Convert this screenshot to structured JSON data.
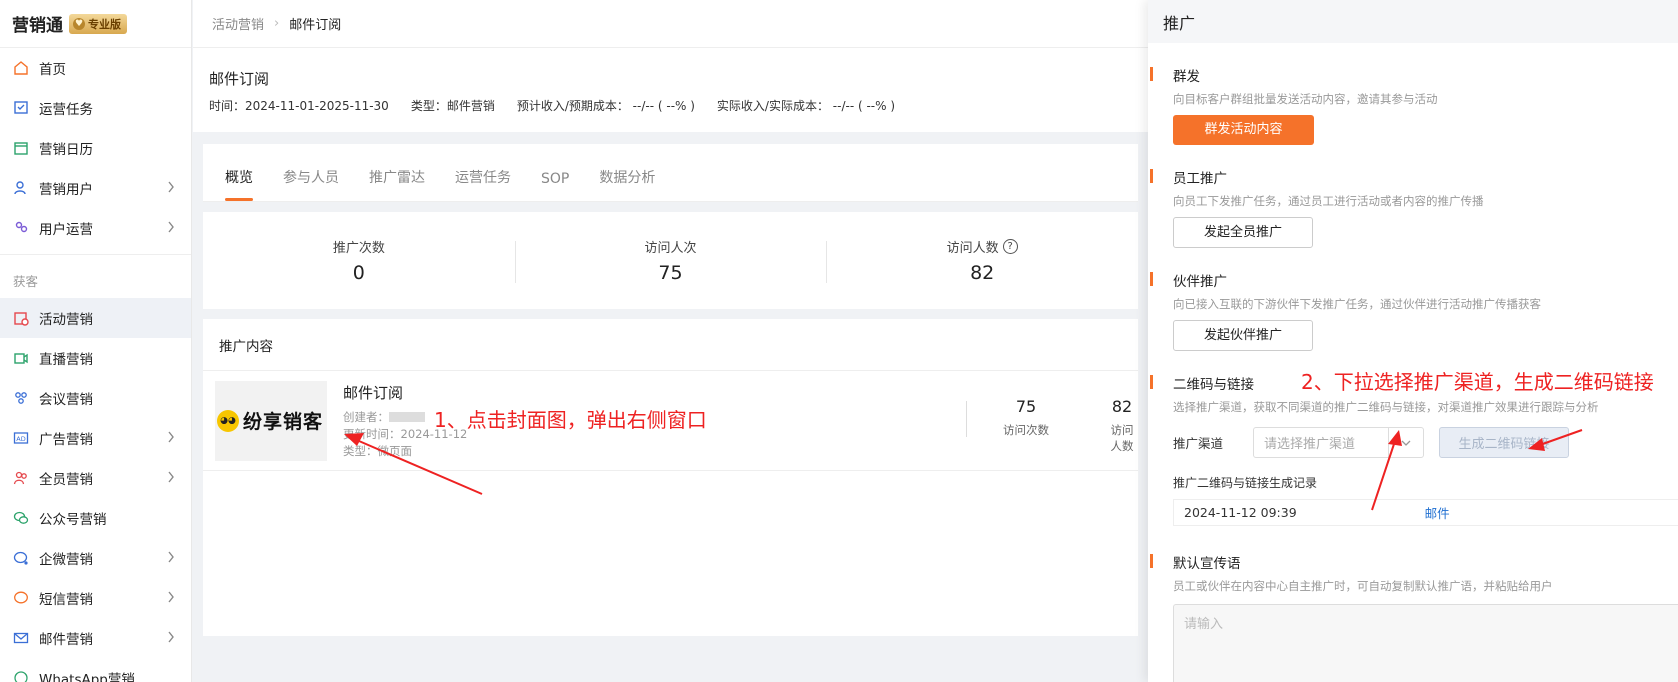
{
  "brand": {
    "name": "营销通",
    "badge": "专业版"
  },
  "sidebar": {
    "items": [
      {
        "label": "首页",
        "icon": "home-icon"
      },
      {
        "label": "运营任务",
        "icon": "task-icon"
      },
      {
        "label": "营销日历",
        "icon": "calendar-icon"
      },
      {
        "label": "营销用户",
        "icon": "user-icon"
      },
      {
        "label": "用户运营",
        "icon": "users-icon"
      }
    ],
    "group_label": "获客",
    "group_items": [
      {
        "label": "活动营销",
        "icon": "activity-icon"
      },
      {
        "label": "直播营销",
        "icon": "video-icon"
      },
      {
        "label": "会议营销",
        "icon": "meeting-icon"
      },
      {
        "label": "广告营销",
        "icon": "ad-icon"
      },
      {
        "label": "全员营销",
        "icon": "people-icon"
      },
      {
        "label": "公众号营销",
        "icon": "wechat-icon"
      },
      {
        "label": "企微营销",
        "icon": "wecom-icon"
      },
      {
        "label": "短信营销",
        "icon": "sms-icon"
      },
      {
        "label": "邮件营销",
        "icon": "mail-icon"
      },
      {
        "label": "WhatsApp营销",
        "icon": "whatsapp-icon"
      }
    ]
  },
  "breadcrumb": {
    "parent": "活动营销",
    "current": "邮件订阅"
  },
  "header": {
    "title": "邮件订阅",
    "time": "时间：2024-11-01-2025-11-30",
    "type": "类型：邮件营销",
    "expected": "预计收入/预期成本： --/-- ( --% )",
    "actual": "实际收入/实际成本： --/-- ( --% )"
  },
  "tabs": [
    "概览",
    "参与人员",
    "推广雷达",
    "运营任务",
    "SOP",
    "数据分析"
  ],
  "stats": [
    {
      "label": "推广次数",
      "value": "0"
    },
    {
      "label": "访问人次",
      "value": "75"
    },
    {
      "label": "访问人数",
      "value": "82"
    }
  ],
  "content": {
    "section_title": "推广内容",
    "item": {
      "cover_text": "纷享销客",
      "title": "邮件订阅",
      "creator_label": "创建者：",
      "updated": "更新时间：2024-11-12",
      "type": "类型：微页面",
      "visits": "75",
      "visits_label": "访问次数",
      "visitors": "82",
      "visitors_label": "访问人数"
    }
  },
  "annotations": {
    "step1": "1、点击封面图，弹出右侧窗口",
    "step2": "2、下拉选择推广渠道，生成二维码链接"
  },
  "drawer": {
    "title": "推广",
    "mass": {
      "title": "群发",
      "desc": "向目标客户群组批量发送活动内容，邀请其参与活动",
      "button": "群发活动内容"
    },
    "employee": {
      "title": "员工推广",
      "desc": "向员工下发推广任务，通过员工进行活动或者内容的推广传播",
      "button": "发起全员推广"
    },
    "partner": {
      "title": "伙伴推广",
      "desc": "向已接入互联的下游伙伴下发推广任务，通过伙伴进行活动推广传播获客",
      "button": "发起伙伴推广"
    },
    "qrcode": {
      "title": "二维码与链接",
      "desc": "选择推广渠道，获取不同渠道的推广二维码与链接，对渠道推广效果进行跟踪与分析",
      "channel_label": "推广渠道",
      "channel_placeholder": "请选择推广渠道",
      "generate_button": "生成二维码链接",
      "record_title": "推广二维码与链接生成记录",
      "record_time": "2024-11-12 09:39",
      "record_channel": "邮件"
    },
    "slogan": {
      "title": "默认宣传语",
      "desc": "员工或伙伴在内容中心自主推广时，可自动复制默认推广语，并粘贴给用户",
      "placeholder": "请输入"
    }
  },
  "colors": {
    "accent": "#f5722a",
    "annotation": "#ee2222",
    "link": "#1f6fd1"
  }
}
